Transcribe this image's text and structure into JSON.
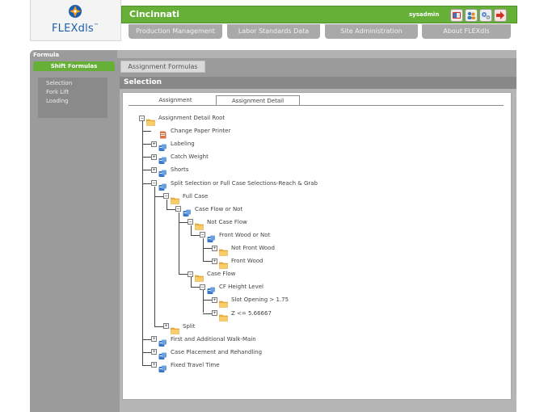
{
  "header": {
    "logo_text": "FLEXdls",
    "logo_tm": "™",
    "location": "Cincinnati",
    "username": "sysadmin",
    "icons": [
      "book-icon",
      "people-icon",
      "gears-icon",
      "logout-icon"
    ]
  },
  "nav": {
    "tabs": [
      {
        "label": "Production Management"
      },
      {
        "label": "Labor Standards Data"
      },
      {
        "label": "Site Administration"
      },
      {
        "label": "About FLEXdls"
      }
    ]
  },
  "formula": {
    "section_label": "Formula",
    "shift_tab": "Shift Formulas",
    "assignment_tab": "Assignment Formulas"
  },
  "sidebar": {
    "items": [
      {
        "label": "Selection"
      },
      {
        "label": "Fork Lift"
      },
      {
        "label": "Loading"
      }
    ]
  },
  "panel": {
    "title": "Selection",
    "subtabs": [
      {
        "label": "Assignment",
        "active": false
      },
      {
        "label": "Assignment Detail",
        "active": true
      }
    ]
  },
  "tree": {
    "nodes": [
      {
        "label": "Assignment Detail Root",
        "icon": "folder-icon",
        "toggle": "−"
      },
      {
        "label": "Change Paper Printer",
        "icon": "document-icon",
        "toggle": ""
      },
      {
        "label": "Labeling",
        "icon": "formula-icon",
        "toggle": "+"
      },
      {
        "label": "Catch Weight",
        "icon": "formula-icon",
        "toggle": "+"
      },
      {
        "label": "Shorts",
        "icon": "formula-icon",
        "toggle": "+"
      },
      {
        "label": "Split Selection or Full Case Selections-Reach & Grab",
        "icon": "formula-icon",
        "toggle": "−"
      },
      {
        "label": "Full Case",
        "icon": "folder-icon",
        "toggle": "−"
      },
      {
        "label": "Case Flow or Not",
        "icon": "formula-icon",
        "toggle": "−"
      },
      {
        "label": "Not Case Flow",
        "icon": "folder-icon",
        "toggle": "−"
      },
      {
        "label": "Front Wood or Not",
        "icon": "formula-icon",
        "toggle": "−"
      },
      {
        "label": "Not Front Wood",
        "icon": "folder-icon",
        "toggle": "+"
      },
      {
        "label": "Front Wood",
        "icon": "folder-icon",
        "toggle": "+"
      },
      {
        "label": "Case Flow",
        "icon": "folder-icon",
        "toggle": "−"
      },
      {
        "label": "CF Height Level",
        "icon": "formula-icon",
        "toggle": "−"
      },
      {
        "label": "Slot Opening > 1.75",
        "icon": "folder-icon",
        "toggle": "+"
      },
      {
        "label": "Z <= 5.66667",
        "icon": "folder-icon",
        "toggle": "+"
      },
      {
        "label": "Split",
        "icon": "folder-icon",
        "toggle": "+"
      },
      {
        "label": "First and Additional Walk-Main",
        "icon": "formula-icon",
        "toggle": "+"
      },
      {
        "label": "Case Placement and Rehandling",
        "icon": "formula-icon",
        "toggle": "+"
      },
      {
        "label": "Fixed Travel Time",
        "icon": "formula-icon",
        "toggle": "+"
      }
    ]
  },
  "colors": {
    "accent_green": "#67b038",
    "nav_gray": "#a9a9a9",
    "frame_gray": "#9b9b9b",
    "logo_blue": "#1d5fae"
  }
}
